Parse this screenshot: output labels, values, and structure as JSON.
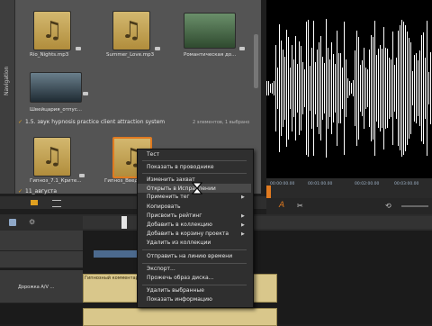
{
  "navigation": {
    "label": "Navigation"
  },
  "library": {
    "row1": [
      {
        "name": "Rio_Nights.mp3",
        "kind": "audio"
      },
      {
        "name": "Summer_Love.mp3",
        "kind": "audio"
      },
      {
        "name": "Романтическая до...",
        "kind": "video"
      }
    ],
    "row2": [
      {
        "name": "Швейцария_отпус...",
        "kind": "screen"
      }
    ],
    "group1": {
      "title": "1.5. звук hypnosis practice client attraction system",
      "info": "2 элементов, 1 выбрано"
    },
    "row3": [
      {
        "name": "Гипноз_7.1_Крите...",
        "kind": "audio"
      },
      {
        "name": "Гипноз_Введ...",
        "kind": "audio"
      }
    ],
    "group2": {
      "title": "11_августа"
    }
  },
  "ruler": {
    "ticks": [
      "00:00:00.00",
      "00:01:00.00",
      "00:02:00.00",
      "00:03:00.00"
    ]
  },
  "timeline": {
    "track_label": "Дорожка A/V ...",
    "clip_label": "Гипнозный комментар..."
  },
  "context_menu": {
    "items": [
      {
        "label": "Тест",
        "submenu": false
      },
      {
        "label": "Показать в проводнике",
        "submenu": false
      },
      {
        "label": "Изменить захват",
        "submenu": false
      },
      {
        "label": "Открыть в Исправлении",
        "submenu": false,
        "hovered": true
      },
      {
        "label": "Применить тег",
        "submenu": true
      },
      {
        "label": "Копировать",
        "submenu": false
      },
      {
        "label": "Присвоить рейтинг",
        "submenu": true
      },
      {
        "label": "Добавить в коллекцию",
        "submenu": true
      },
      {
        "label": "Добавить в корзину проекта",
        "submenu": true
      },
      {
        "label": "Удалить из коллекции",
        "submenu": false
      },
      {
        "label": "Отправить на линию времени",
        "submenu": false
      },
      {
        "label": "Экспорт...",
        "submenu": false
      },
      {
        "label": "Прожечь образ диска...",
        "submenu": false
      },
      {
        "label": "Удалить выбранные",
        "submenu": false
      },
      {
        "label": "Показать информацию",
        "submenu": false
      }
    ]
  },
  "colors": {
    "accent": "#e0a020",
    "selection": "#e07a20"
  }
}
